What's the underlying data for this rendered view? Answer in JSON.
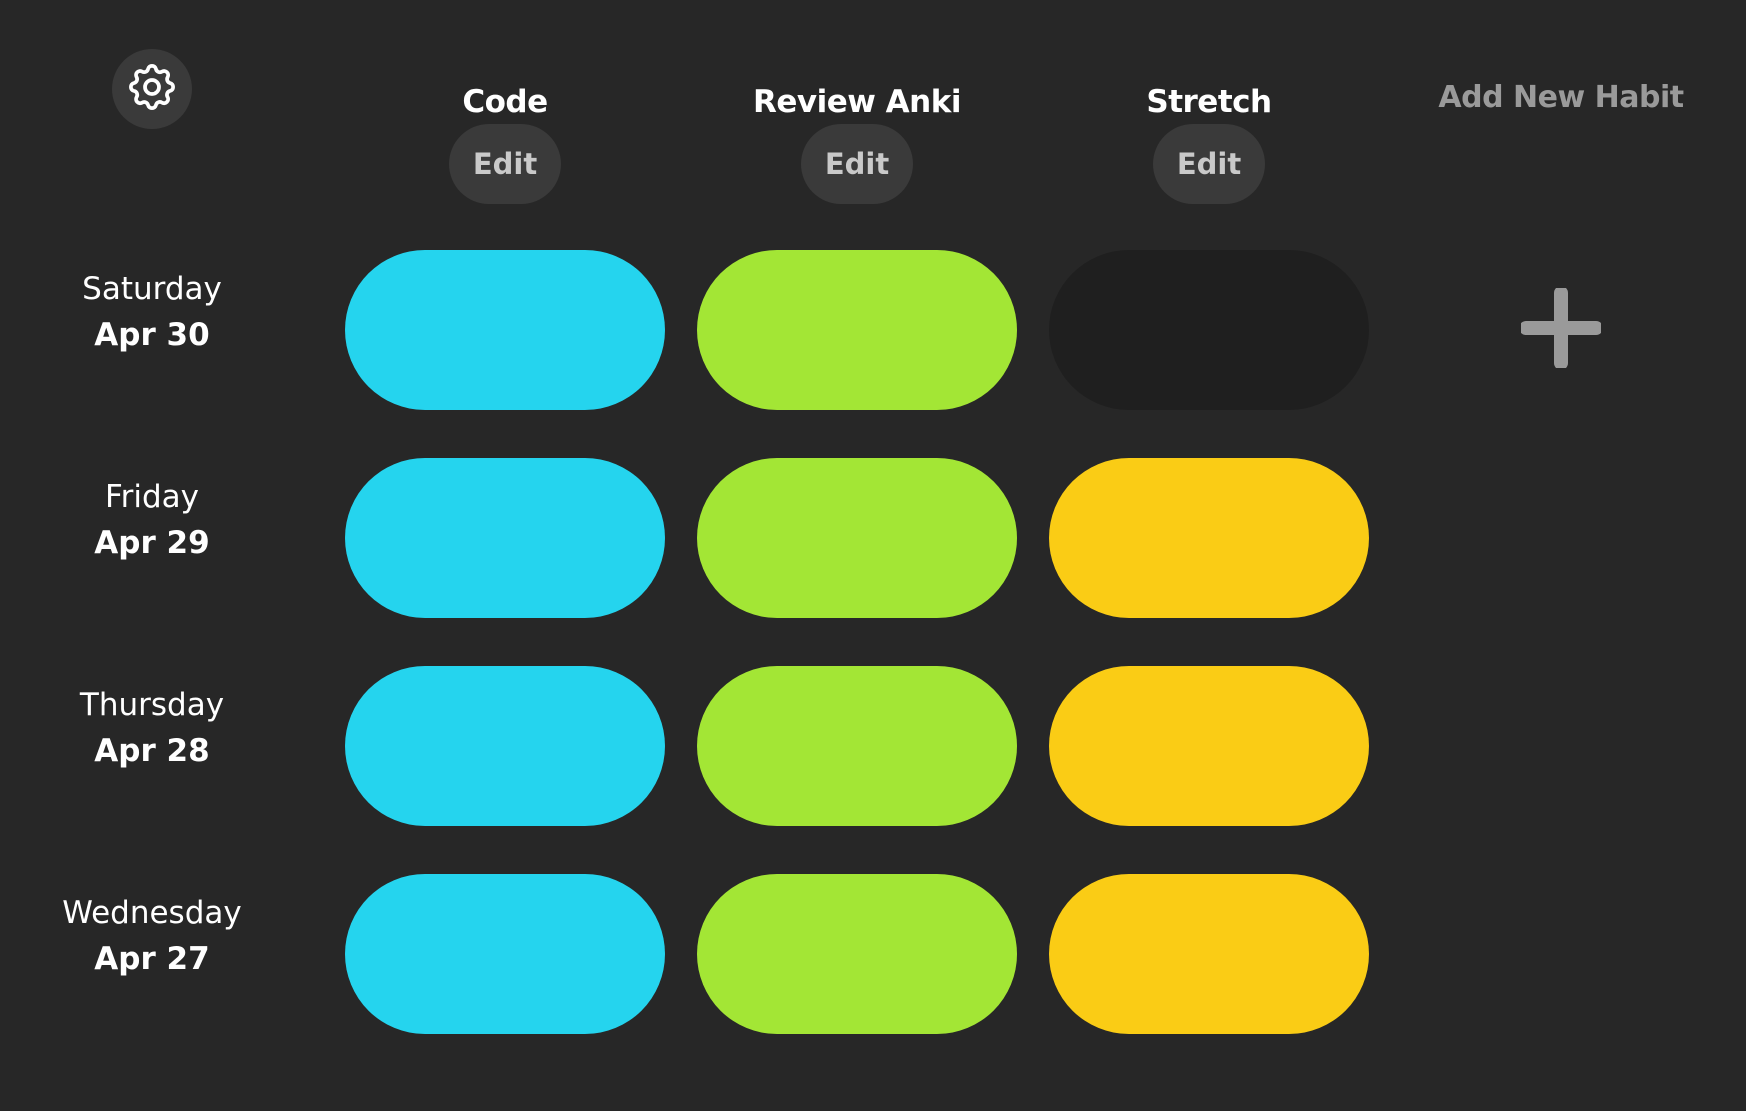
{
  "settings": {
    "icon": "gear-icon"
  },
  "habits": [
    {
      "name": "Code",
      "edit_label": "Edit",
      "color": "#25D4EE"
    },
    {
      "name": "Review Anki",
      "edit_label": "Edit",
      "color": "#A3E635"
    },
    {
      "name": "Stretch",
      "edit_label": "Edit",
      "color": "#FACC15"
    }
  ],
  "add_habit": {
    "label": "Add New Habit",
    "icon": "plus-icon",
    "color": "#9a9a9a"
  },
  "days": [
    {
      "weekday": "Saturday",
      "date": "Apr 30",
      "done": [
        true,
        true,
        false
      ]
    },
    {
      "weekday": "Friday",
      "date": "Apr 29",
      "done": [
        true,
        true,
        true
      ]
    },
    {
      "weekday": "Thursday",
      "date": "Apr 28",
      "done": [
        true,
        true,
        true
      ]
    },
    {
      "weekday": "Wednesday",
      "date": "Apr 27",
      "done": [
        true,
        true,
        true
      ]
    }
  ],
  "colors": {
    "background": "#272727",
    "button": "#3a3a3a",
    "empty_cell": "#1f1f1f"
  }
}
